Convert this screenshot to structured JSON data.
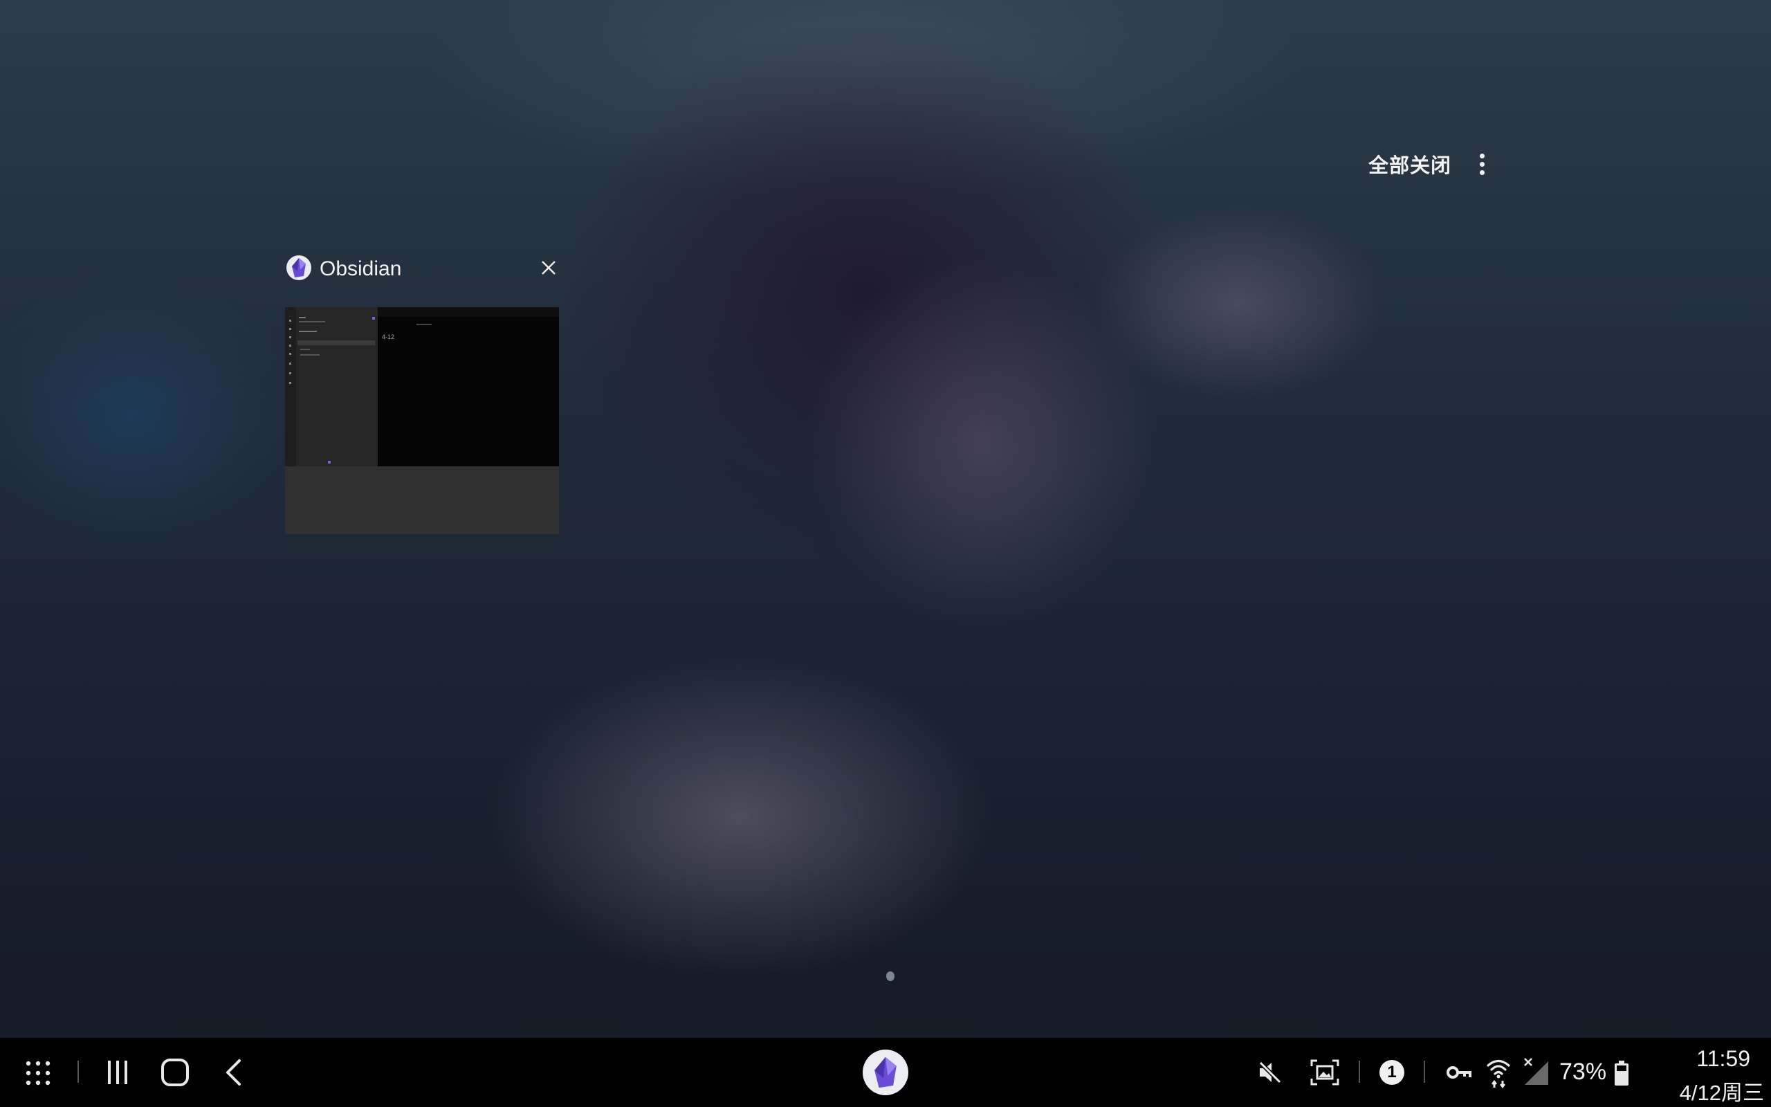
{
  "recents": {
    "close_all_label": "全部关闭",
    "more_options_icon": "more-vert-icon"
  },
  "card": {
    "app_name": "Obsidian",
    "app_icon": "obsidian-icon",
    "close_icon": "close-icon",
    "thumbnail": {
      "note_date": "4-12",
      "sidebar_file": "Untitled",
      "accent_color": "#7c5fe6"
    }
  },
  "taskbar": {
    "apps_drawer_icon": "apps-grid-icon",
    "recents_icon": "recents-icon",
    "home_icon": "home-icon",
    "back_icon": "back-icon",
    "pinned_app_icon": "obsidian-icon",
    "status": {
      "mute_icon": "mute-icon",
      "screenshot_icon": "screen-capture-icon",
      "notification_count": "1",
      "vpn_icon": "key-icon",
      "wifi_icon": "wifi-icon",
      "signal_icon": "no-signal-icon",
      "battery_percent": "73%",
      "battery_icon": "battery-icon",
      "time": "11:59",
      "date": "4/12周三"
    }
  }
}
